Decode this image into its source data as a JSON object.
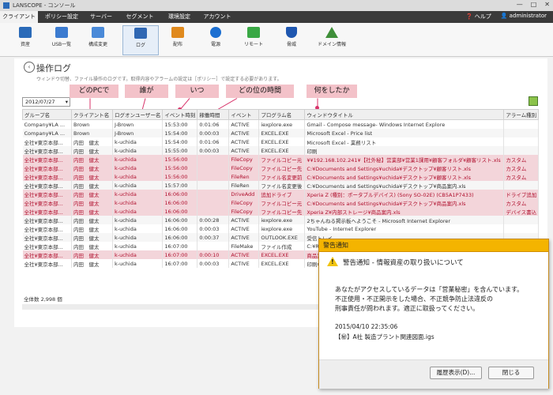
{
  "window": {
    "title": "LANSCOPE - コンソール",
    "controls": [
      "—",
      "□",
      "✕"
    ]
  },
  "menubar": {
    "tabs": [
      "クライアント",
      "ポリシー設定",
      "サーバー",
      "セグメント",
      "環境設定",
      "アカウント"
    ],
    "active": 0,
    "help": "ヘルプ",
    "user": "administrator"
  },
  "toolbar": {
    "items": [
      {
        "label": "資産",
        "icon": "monitor-icon",
        "color": "#2a6ab8"
      },
      {
        "label": "USB一覧",
        "icon": "usb-icon",
        "color": "#3b7bd0"
      },
      {
        "label": "構成変更",
        "icon": "config-icon",
        "color": "#4a8ad8"
      },
      {
        "label": "ログ",
        "icon": "log-icon",
        "color": "#2f67b3"
      },
      {
        "label": "配布",
        "icon": "distribute-icon",
        "color": "#e08a1e"
      },
      {
        "label": "電源",
        "icon": "power-icon",
        "color": "#1c6fd1"
      },
      {
        "label": "リモート",
        "icon": "remote-icon",
        "color": "#39a845"
      },
      {
        "label": "脅威",
        "icon": "shield-icon",
        "color": "#1f57b0"
      },
      {
        "label": "ドメイン情報",
        "icon": "domain-icon",
        "color": "#3f8f3a"
      }
    ],
    "active": 3
  },
  "page": {
    "title": "操作ログ",
    "description": "ウィンドウ切替、ファイル操作のログです。取得内容やアラームの設定は［ポリシー］で設定する必要があります。",
    "date": "2012/07/27",
    "total": "全体数 2,998 個"
  },
  "callouts": [
    "どのPCで",
    "誰が",
    "いつ",
    "どの位の時間",
    "何をしたか"
  ],
  "grid": {
    "headers": [
      "グループ名",
      "クライアント名",
      "ログオンユーザー名",
      "イベント時刻",
      "稼働時間",
      "イベント",
      "プログラム名",
      "ウィンドウタイトル",
      "アラーム種別"
    ],
    "rows": [
      {
        "hl": false,
        "cells": [
          "Company¥LA ...",
          "Brown",
          "J-Brown",
          "15:53:00",
          "0:01:06",
          "ACTIVE",
          "iexplore.exe",
          "Gmail - Compose message- Windows Internet Explore",
          ""
        ]
      },
      {
        "hl": false,
        "cells": [
          "Company¥LA ...",
          "Brown",
          "J-Brown",
          "15:54:00",
          "0:00:03",
          "ACTIVE",
          "EXCEL.EXE",
          "Microsoft Excel - Price list",
          ""
        ]
      },
      {
        "hl": false,
        "cells": [
          "全社¥東京本部...",
          "内田　健太",
          "k-uchida",
          "15:54:00",
          "0:01:06",
          "ACTIVE",
          "EXCEL.EXE",
          "Microsoft Excel - 業務リスト",
          ""
        ]
      },
      {
        "hl": false,
        "cells": [
          "全社¥東京本部...",
          "内田　健太",
          "k-uchida",
          "15:55:00",
          "0:00:03",
          "ACTIVE",
          "EXCEL.EXE",
          "印刷",
          ""
        ]
      },
      {
        "hl": true,
        "cells": [
          "全社¥東京本部...",
          "内田　健太",
          "k-uchida",
          "15:56:00",
          "",
          "FileCopy",
          "ファイルコピー元",
          "¥¥192.168.102.241¥【社外秘】営業部¥営業1課用¥顧客フォルダ¥顧客リスト.xls",
          "カスタム"
        ]
      },
      {
        "hl": true,
        "cells": [
          "全社¥東京本部...",
          "内田　健太",
          "k-uchida",
          "15:56:00",
          "",
          "FileCopy",
          "ファイルコピー先",
          "C:¥Documents and Settings¥uchida¥デスクトップ¥顧客リスト.xls",
          "カスタム"
        ]
      },
      {
        "hl": true,
        "cells": [
          "全社¥東京本部...",
          "内田　健太",
          "k-uchida",
          "15:56:00",
          "",
          "FileRen",
          "ファイル名変更前",
          "C:¥Documents and Settings¥uchida¥デスクトップ¥顧客リスト.xls",
          "カスタム"
        ]
      },
      {
        "hl": false,
        "cells": [
          "全社¥東京本部...",
          "内田　健太",
          "k-uchida",
          "15:57:00",
          "",
          "FileRen",
          "ファイル名変更後",
          "C:¥Documents and Settings¥uchida¥デスクトップ¥商品案内.xls",
          ""
        ]
      },
      {
        "hl": true,
        "cells": [
          "全社¥東京本部...",
          "内田　健太",
          "k-uchida",
          "16:06:00",
          "",
          "DriveAdd",
          "追加ドライブ",
          "Xperia Z (種別：ポータブルデバイス) (Sony SO-02E) (CB5A1P7433)",
          "ドライブ追加"
        ]
      },
      {
        "hl": true,
        "cells": [
          "全社¥東京本部...",
          "内田　健太",
          "k-uchida",
          "16:06:00",
          "",
          "FileCopy",
          "ファイルコピー元",
          "C:¥Documents and Settings¥uchida¥デスクトップ¥商品案内.xls",
          "カスタム"
        ]
      },
      {
        "hl": true,
        "cells": [
          "全社¥東京本部...",
          "内田　健太",
          "k-uchida",
          "16:06:00",
          "",
          "FileCopy",
          "ファイルコピー先",
          "Xperia Z¥内部ストレージ¥商品案内.xls",
          "デバイス書込"
        ]
      },
      {
        "hl": false,
        "cells": [
          "全社¥東京本部...",
          "内田　健太",
          "k-uchida",
          "16:06:00",
          "0:00:28",
          "ACTIVE",
          "iexplore.exe",
          "2ちゃんねる掲示板へようこそ - Microsoft Internet Explorer",
          ""
        ]
      },
      {
        "hl": false,
        "cells": [
          "全社¥東京本部...",
          "内田　健太",
          "k-uchida",
          "16:06:00",
          "0:00:03",
          "ACTIVE",
          "iexplore.exe",
          "YouTube - Internet Explorer",
          ""
        ]
      },
      {
        "hl": false,
        "cells": [
          "全社¥東京本部...",
          "内田　健太",
          "k-uchida",
          "16:06:00",
          "0:00:37",
          "ACTIVE",
          "OUTLOOK.EXE",
          "受信トレイ",
          ""
        ]
      },
      {
        "hl": false,
        "cells": [
          "全社¥東京本部...",
          "内田　健太",
          "k-uchida",
          "16:07:00",
          "",
          "FileMake",
          "ファイル作成",
          "C:¥RECY",
          ""
        ]
      },
      {
        "hl": true,
        "cells": [
          "全社¥東京本部...",
          "内田　健太",
          "k-uchida",
          "16:07:00",
          "0:00:10",
          "ACTIVE",
          "EXCEL.EXE",
          "商品案内",
          ""
        ]
      },
      {
        "hl": false,
        "cells": [
          "全社¥東京本部...",
          "内田　健太",
          "k-uchida",
          "16:07:00",
          "0:00:03",
          "ACTIVE",
          "EXCEL.EXE",
          "印刷中",
          ""
        ]
      }
    ]
  },
  "dialog": {
    "title": "警告通知",
    "heading": "警告通知 - 情報資産の取り扱いについて",
    "message": [
      "あなたがアクセスしているデータは「営業秘密」を含んでいます。",
      "不正使用・不正開示をした場合、不正競争防止法違反の",
      "刑事責任が問われます。適正に取扱ってください。"
    ],
    "time": "2015/04/10 22:35:06",
    "file": "【㊙】A社 製造プラント関連図面.igs",
    "btn_history": "履歴表示(D)...",
    "btn_close": "閉じる"
  }
}
